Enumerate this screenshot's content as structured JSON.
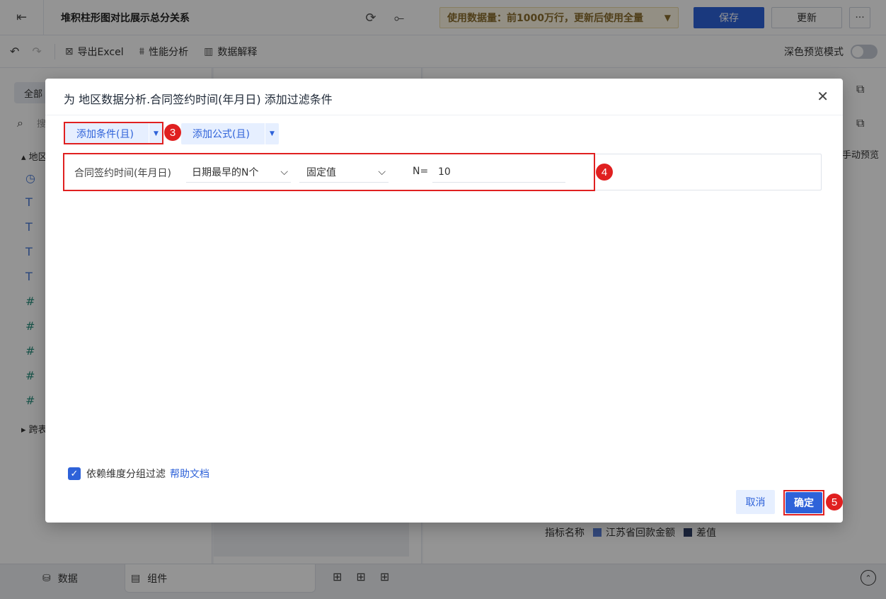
{
  "app": {
    "title": "堆积柱形图对比展示总分关系",
    "data_notice": "使用数据量：前1000万行，更新后使用全量",
    "save_label": "保存",
    "update_label": "更新",
    "more_label": "···"
  },
  "toolbar": {
    "export_label": "导出Excel",
    "perf_label": "性能分析",
    "explain_label": "数据解释",
    "dark_mode_label": "深色预览模式"
  },
  "left_panel": {
    "chip_label": "全部",
    "search_placeholder": "搜",
    "group_label": "地区",
    "group2_label": "跨表"
  },
  "right_panel": {
    "hand_preview_label": "手动预览",
    "legend": {
      "title": "指标名称",
      "items": [
        {
          "label": "江苏省回款金额",
          "color": "#5b7fd6"
        },
        {
          "label": "差值",
          "color": "#2f3e66"
        }
      ]
    }
  },
  "bottom": {
    "data_tab": "数据",
    "component_tab": "组件"
  },
  "dialog": {
    "title": "为 地区数据分析.合同签约时间(年月日) 添加过滤条件",
    "add_condition_label": "添加条件(且)",
    "add_formula_label": "添加公式(且)",
    "condition": {
      "field": "合同签约时间(年月日)",
      "type": "日期最早的N个",
      "mode": "固定值",
      "n_label": "N=",
      "n_value": "10"
    },
    "dependency_label": "依赖维度分组过滤",
    "help_link": "帮助文档",
    "cancel_label": "取消",
    "ok_label": "确定",
    "badges": [
      "3",
      "4",
      "5"
    ],
    "highlight_color": "#e02020",
    "accent_color": "#2e62d9"
  }
}
